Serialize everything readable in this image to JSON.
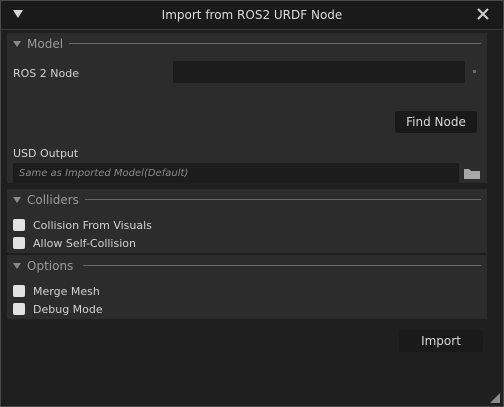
{
  "window": {
    "title": "Import from ROS2 URDF Node"
  },
  "model": {
    "section_label": "Model",
    "ros2_node_label": "ROS 2 Node",
    "ros2_node_value": "",
    "find_node_label": "Find Node",
    "usd_output_label": "USD Output",
    "usd_output_placeholder": "Same as Imported Model(Default)"
  },
  "colliders": {
    "section_label": "Colliders",
    "options": [
      {
        "label": "Collision From Visuals",
        "checked": false
      },
      {
        "label": "Allow Self-Collision",
        "checked": false
      }
    ]
  },
  "options": {
    "section_label": "Options",
    "options": [
      {
        "label": "Merge Mesh",
        "checked": false
      },
      {
        "label": "Debug Mode",
        "checked": false
      }
    ]
  },
  "footer": {
    "import_label": "Import"
  }
}
